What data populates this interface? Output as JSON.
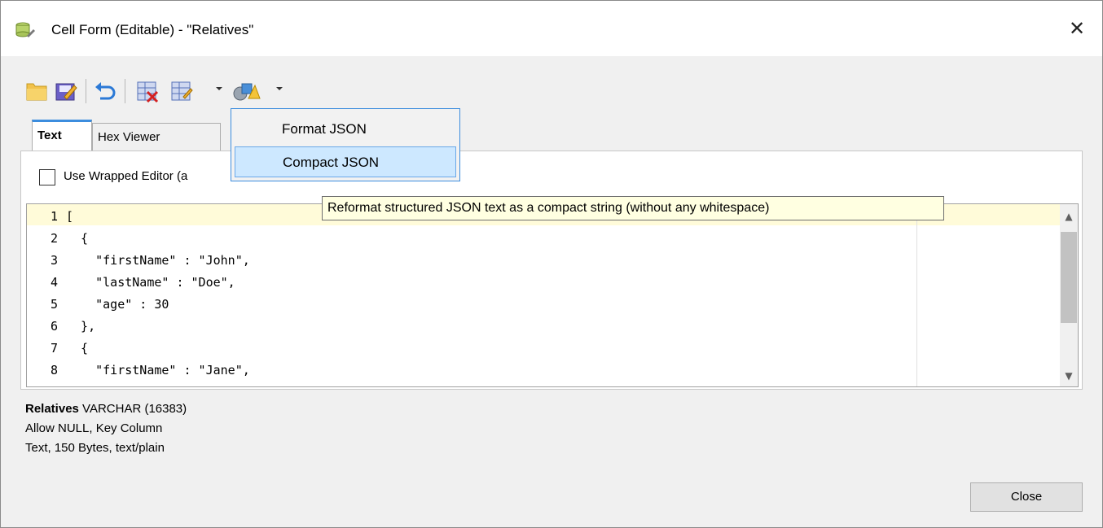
{
  "window": {
    "title": "Cell Form (Editable) - \"Relatives\"",
    "close_glyph": "✕"
  },
  "toolbar": {
    "items": [
      "open-folder-icon",
      "save-edit-icon",
      "undo-icon",
      "delete-icon",
      "table-edit-icon",
      "json-format-icon"
    ]
  },
  "tabs": [
    {
      "label": "Text",
      "active": true
    },
    {
      "label": "Hex Viewer",
      "active": false
    }
  ],
  "options": {
    "wrapped_editor_label": "Use Wrapped Editor (a",
    "wrapped_editor_checked": false
  },
  "editor": {
    "line_numbers": [
      "1",
      "2",
      "3",
      "4",
      "5",
      "6",
      "7",
      "8"
    ],
    "lines": [
      "[",
      "  {",
      "    \"firstName\" : \"John\",",
      "    \"lastName\" : \"Doe\",",
      "    \"age\" : 30",
      "  },",
      "  {",
      "    \"firstName\" : \"Jane\","
    ]
  },
  "column_info": {
    "name": "Relatives",
    "type": "VARCHAR (16383)",
    "flags": "Allow NULL, Key Column",
    "content": "Text, 150 Bytes, text/plain"
  },
  "menu": {
    "items": [
      {
        "label": "Format JSON",
        "highlighted": false
      },
      {
        "label": "Compact JSON",
        "highlighted": true
      }
    ]
  },
  "tooltip": {
    "text": "Reformat structured JSON text as a compact string (without any whitespace)"
  },
  "buttons": {
    "close": "Close"
  },
  "colors": {
    "accent": "#3c8dde",
    "highlight_line": "#fffbd9",
    "tooltip_bg": "#ffffe1",
    "menu_hover": "#cde8ff"
  }
}
